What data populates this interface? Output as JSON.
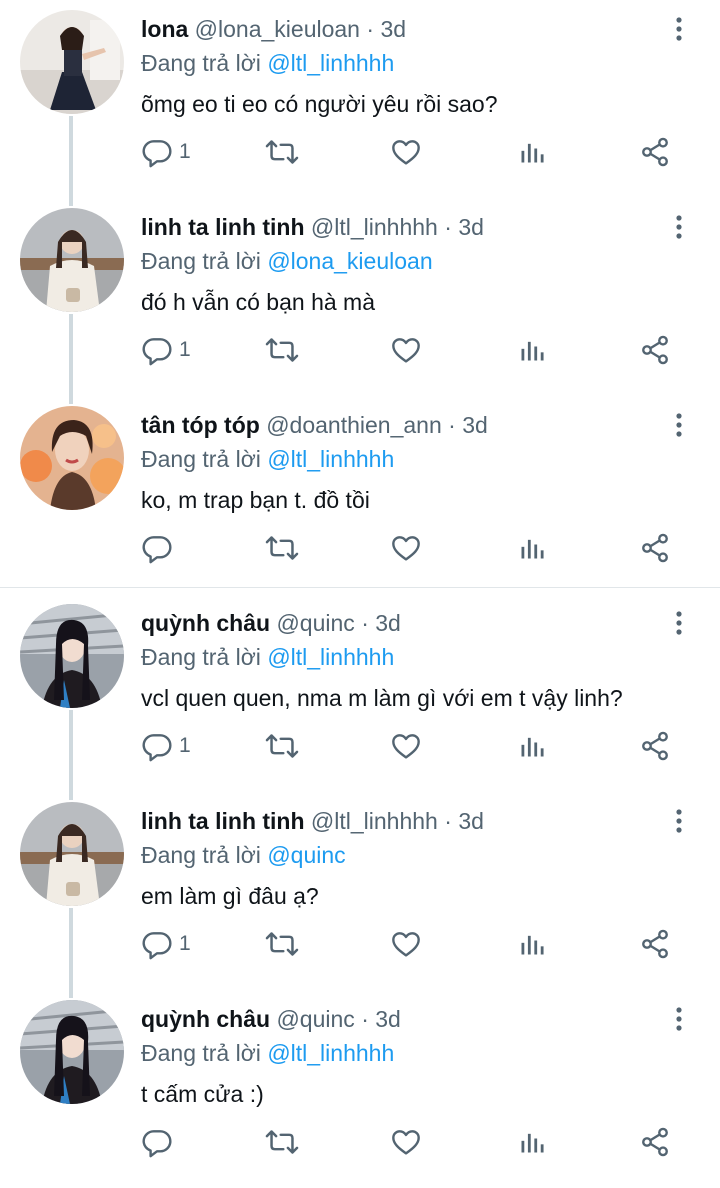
{
  "replying_prefix": "Đang trả lời",
  "colors": {
    "accent": "#1d9bf0",
    "muted": "#536471",
    "thread_line": "#cfd9de"
  },
  "icons": [
    "more-vertical-icon",
    "reply-icon",
    "retweet-icon",
    "like-icon",
    "views-icon",
    "share-icon"
  ],
  "tweets": [
    {
      "name": "lona",
      "handle": "@lona_kieuloan",
      "sep": "·",
      "time": "3d",
      "reply_to": "@ltl_linhhhh",
      "text": "õmg eo ti eo có người yêu rồi sao?",
      "reply_count": "1",
      "avatar": "avatar-lona"
    },
    {
      "name": "linh ta linh tinh",
      "handle": "@ltl_linhhhh",
      "sep": "·",
      "time": "3d",
      "reply_to": "@lona_kieuloan",
      "text": "đó h vẫn có bạn hà mà",
      "reply_count": "1",
      "avatar": "avatar-linh"
    },
    {
      "name": "tân tóp tóp",
      "handle": "@doanthien_ann",
      "sep": "·",
      "time": "3d",
      "reply_to": "@ltl_linhhhh",
      "text": "ko, m trap bạn t. đồ tồi",
      "reply_count": "",
      "avatar": "avatar-tan"
    },
    {
      "name": "quỳnh châu",
      "handle": "@quinc",
      "sep": "·",
      "time": "3d",
      "reply_to": "@ltl_linhhhh",
      "text": "vcl quen quen, nma m làm gì với em t vậy linh?",
      "reply_count": "1",
      "avatar": "avatar-quynh"
    },
    {
      "name": "linh ta linh tinh",
      "handle": "@ltl_linhhhh",
      "sep": "·",
      "time": "3d",
      "reply_to": "@quinc",
      "text": "em làm gì đâu ạ?",
      "reply_count": "1",
      "avatar": "avatar-linh"
    },
    {
      "name": "quỳnh châu",
      "handle": "@quinc",
      "sep": "·",
      "time": "3d",
      "reply_to": "@ltl_linhhhh",
      "text": "t cấm cửa :)",
      "reply_count": "",
      "avatar": "avatar-quynh"
    }
  ]
}
